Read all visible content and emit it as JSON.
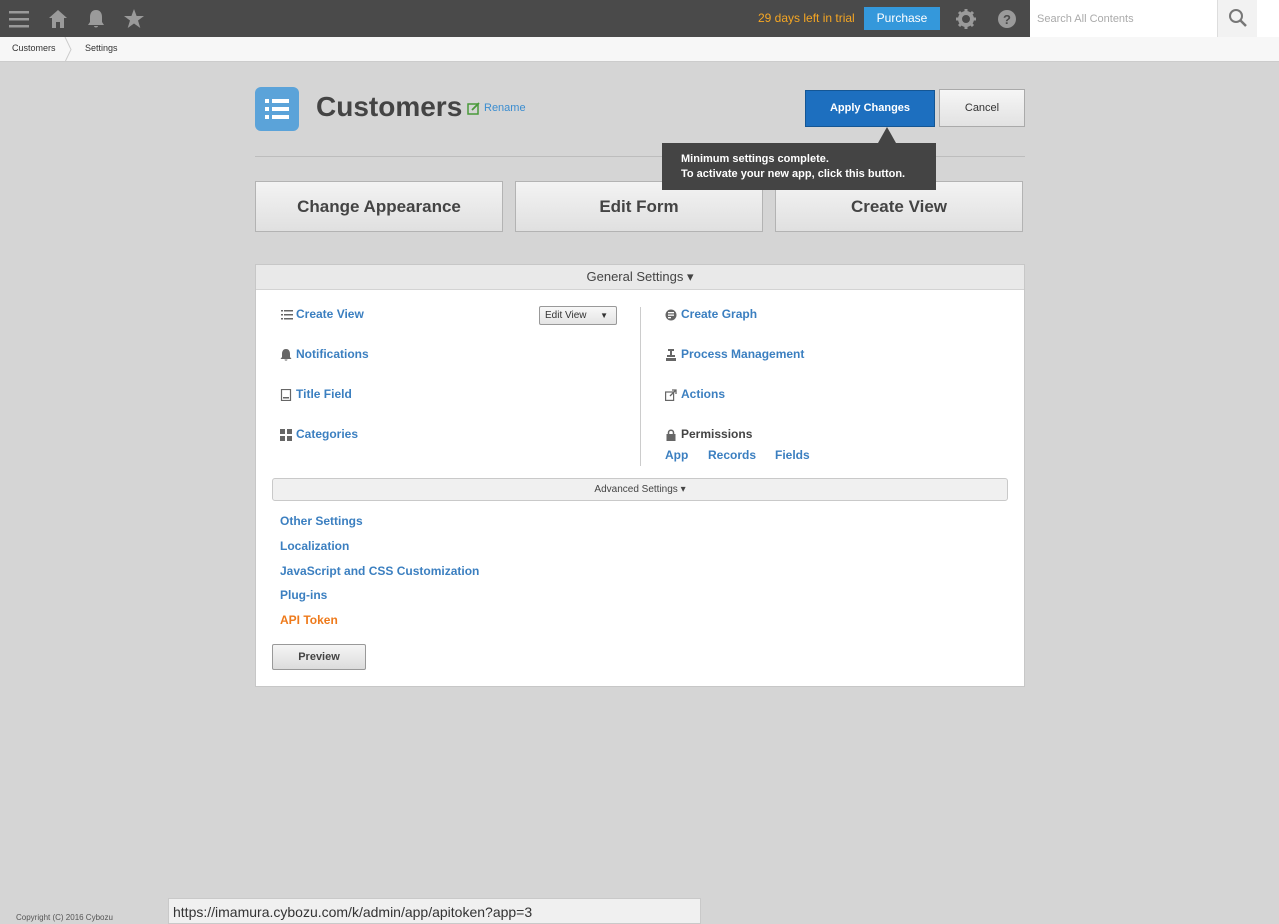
{
  "topbar": {
    "icons": [
      "menu-icon",
      "home-icon",
      "bell-icon",
      "star-icon",
      "gear-icon",
      "help-icon",
      "search-icon"
    ],
    "trial_text": "29 days left in trial",
    "purchase_label": "Purchase",
    "search_placeholder": "Search All Contents"
  },
  "breadcrumb": {
    "items": [
      "Customers",
      "Settings"
    ]
  },
  "header": {
    "title": "Customers",
    "rename_label": "Rename",
    "apply_label": "Apply Changes",
    "cancel_label": "Cancel",
    "tooltip_line1": "Minimum settings complete.",
    "tooltip_line2": "To activate your new app, click this button."
  },
  "big_buttons": [
    "Change Appearance",
    "Edit Form",
    "Create View"
  ],
  "general_settings": {
    "header": "General Settings ▾",
    "left": [
      "Create View",
      "Notifications",
      "Title Field",
      "Categories"
    ],
    "edit_view_label": "Edit View",
    "right": [
      "Create Graph",
      "Process Management",
      "Actions"
    ],
    "permissions_label": "Permissions",
    "permissions_links": [
      "App",
      "Records",
      "Fields"
    ]
  },
  "advanced_settings": {
    "header": "Advanced Settings ▾",
    "items": [
      "Other Settings",
      "Localization",
      "JavaScript and CSS Customization",
      "Plug-ins",
      "API Token"
    ],
    "preview_label": "Preview"
  },
  "footer": {
    "copyright": "Copyright (C) 2016 Cybozu",
    "status_url": "https://imamura.cybozu.com/k/admin/app/apitoken?app=3"
  },
  "colors": {
    "accent_blue": "#1d6fbf",
    "link_blue": "#3b7fc0",
    "trial_orange": "#f5a623",
    "api_token_orange": "#ee7a1b"
  }
}
